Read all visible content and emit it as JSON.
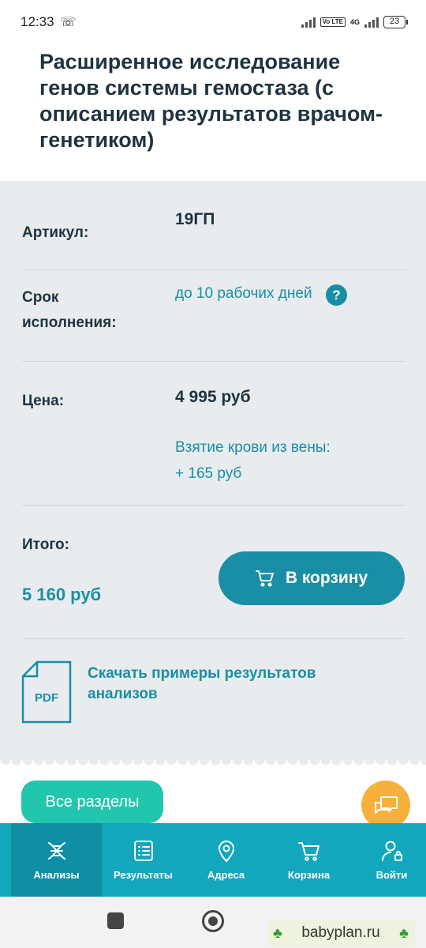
{
  "status_bar": {
    "time": "12:33",
    "volte": "Vo LTE",
    "network": "4G",
    "battery": "23"
  },
  "product": {
    "title": "Расширенное исследование генов системы гемостаза (с описанием результатов врачом- генетиком)"
  },
  "details": {
    "article_label": "Артикул:",
    "article_value": "19ГП",
    "term_label": "Срок исполнения:",
    "term_value": "до 10 рабочих дней",
    "help": "?",
    "price_label": "Цена:",
    "price_value": "4 995 руб",
    "blood_draw": "Взятие крови из вены:",
    "blood_draw_price": "+ 165 руб",
    "total_label": "Итого:",
    "total_value": "5 160 руб",
    "cart_button": "В корзину",
    "pdf_label": "PDF",
    "download_link": "Скачать примеры результатов анализов"
  },
  "floating": {
    "sections_button": "Все разделы"
  },
  "tabs": [
    {
      "label": "Анализы",
      "icon": "dna-icon"
    },
    {
      "label": "Результаты",
      "icon": "list-icon"
    },
    {
      "label": "Адреса",
      "icon": "map-pin-icon"
    },
    {
      "label": "Корзина",
      "icon": "cart-icon"
    },
    {
      "label": "Войти",
      "icon": "user-icon"
    }
  ],
  "watermark": {
    "text": "babyplan.ru"
  },
  "colors": {
    "accent": "#1a8ea5",
    "tabbar": "#12a7bd",
    "sections_button": "#22c6ad",
    "chat_button": "#f6b03b",
    "panel": "#e8ecee"
  }
}
